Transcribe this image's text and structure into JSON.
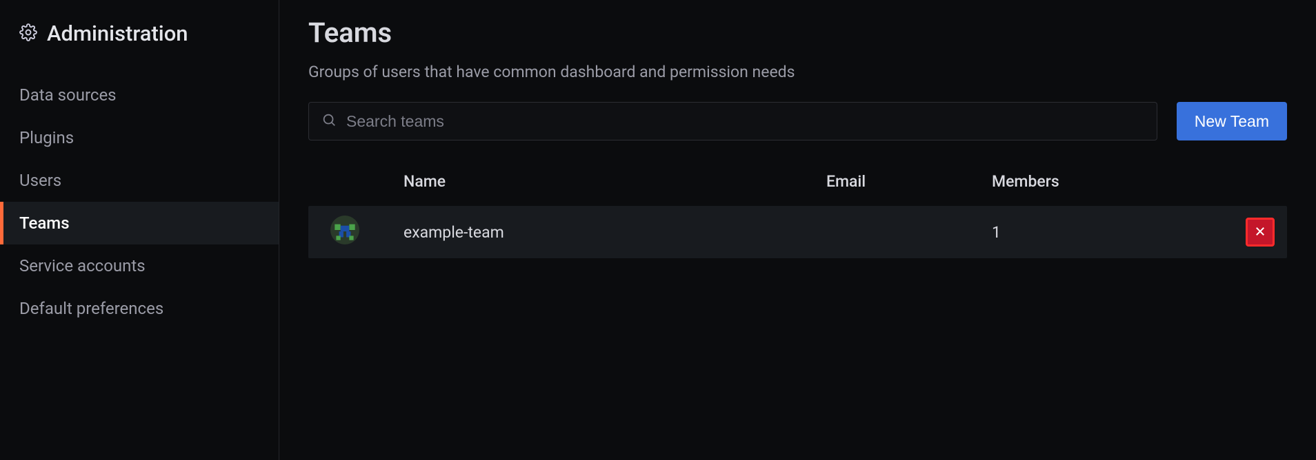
{
  "sidebar": {
    "title": "Administration",
    "items": [
      {
        "label": "Data sources"
      },
      {
        "label": "Plugins"
      },
      {
        "label": "Users"
      },
      {
        "label": "Teams"
      },
      {
        "label": "Service accounts"
      },
      {
        "label": "Default preferences"
      }
    ],
    "active_index": 3
  },
  "page": {
    "title": "Teams",
    "subtitle": "Groups of users that have common dashboard and permission needs"
  },
  "search": {
    "placeholder": "Search teams",
    "value": ""
  },
  "actions": {
    "new_team_label": "New Team"
  },
  "table": {
    "columns": {
      "name": "Name",
      "email": "Email",
      "members": "Members"
    },
    "rows": [
      {
        "name": "example-team",
        "email": "",
        "members": "1"
      }
    ]
  }
}
